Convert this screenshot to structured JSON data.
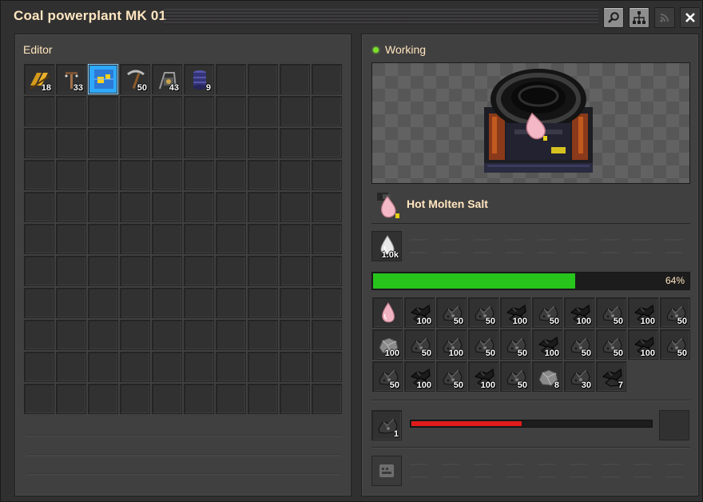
{
  "window": {
    "title": "Coal powerplant MK 01"
  },
  "titlebar_buttons": [
    {
      "name": "search-button",
      "icon": "search-icon"
    },
    {
      "name": "network-button",
      "icon": "network-icon"
    },
    {
      "name": "wifi-button",
      "icon": "wifi-icon"
    },
    {
      "name": "close-button",
      "icon": "close-icon"
    }
  ],
  "editor": {
    "label": "Editor",
    "items": [
      {
        "icon": "belt-icon",
        "qty": "18"
      },
      {
        "icon": "pole-icon",
        "qty": "33"
      },
      {
        "icon": "blueprint-icon",
        "qty": "",
        "selected": true
      },
      {
        "icon": "pickaxe-icon",
        "qty": "50"
      },
      {
        "icon": "crane-icon",
        "qty": "43"
      },
      {
        "icon": "barrel-icon",
        "qty": "9"
      }
    ]
  },
  "machine": {
    "status": "Working",
    "status_color": "#7be22b",
    "recipe_name": "Hot Molten Salt",
    "fluid_amount": "1.0k",
    "progress_percent": 64,
    "progress_label": "64%",
    "fuel_qty": "1",
    "burn_fraction": 0.46,
    "burn_color": "#e11b1b",
    "progress_color": "#27c41c"
  },
  "inventory": [
    {
      "icon": "molten-salt-icon",
      "qty": ""
    },
    {
      "icon": "coal-icon",
      "qty": "100"
    },
    {
      "icon": "coal-ore-icon",
      "qty": "50"
    },
    {
      "icon": "coal-ore-icon",
      "qty": "50"
    },
    {
      "icon": "coal-icon",
      "qty": "100"
    },
    {
      "icon": "coal-ore-icon",
      "qty": "50"
    },
    {
      "icon": "coal-icon",
      "qty": "100"
    },
    {
      "icon": "coal-ore-icon",
      "qty": "50"
    },
    {
      "icon": "coal-icon",
      "qty": "100"
    },
    {
      "icon": "coal-ore-icon",
      "qty": "50"
    },
    {
      "icon": "stone-icon",
      "qty": "100"
    },
    {
      "icon": "coal-ore-icon",
      "qty": "50"
    },
    {
      "icon": "coal-ore-icon",
      "qty": "100"
    },
    {
      "icon": "coal-ore-icon",
      "qty": "50"
    },
    {
      "icon": "coal-ore-icon",
      "qty": "50"
    },
    {
      "icon": "coal-icon",
      "qty": "100"
    },
    {
      "icon": "coal-ore-icon",
      "qty": "50"
    },
    {
      "icon": "coal-ore-icon",
      "qty": "50"
    },
    {
      "icon": "coal-icon",
      "qty": "100"
    },
    {
      "icon": "coal-ore-icon",
      "qty": "50"
    },
    {
      "icon": "coal-ore-icon",
      "qty": "50"
    },
    {
      "icon": "coal-icon",
      "qty": "100"
    },
    {
      "icon": "coal-ore-icon",
      "qty": "50"
    },
    {
      "icon": "coal-icon",
      "qty": "100"
    },
    {
      "icon": "coal-ore-icon",
      "qty": "50"
    },
    {
      "icon": "stone-icon",
      "qty": "8"
    },
    {
      "icon": "coal-ore-icon",
      "qty": "30"
    },
    {
      "icon": "coal-icon",
      "qty": "7"
    }
  ]
}
